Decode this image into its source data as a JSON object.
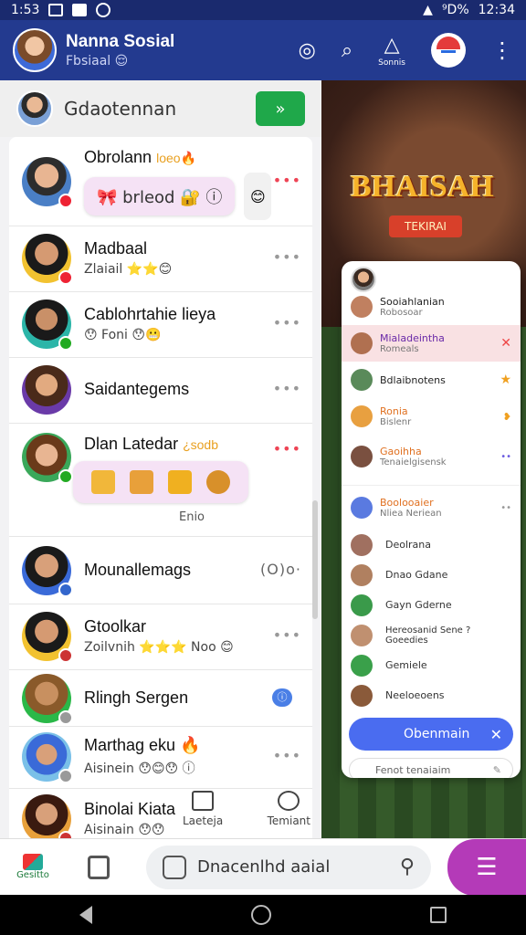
{
  "status": {
    "time": "1:53",
    "battery": "⁹D%",
    "clock": "12:34"
  },
  "app": {
    "title": "Nanna Sosial",
    "subtitle": "Fbsiaal 😌",
    "action_label": "Sonnis"
  },
  "search_head": {
    "name": "Gdaotennan"
  },
  "chats": [
    {
      "name": "Obrolann",
      "tag": "loeo🔥",
      "bubble": "🎀 brleod 🔐 ⓘ"
    },
    {
      "name": "Madbaal",
      "sub": "Zlaiail ⭐⭐😊"
    },
    {
      "name": "Cablohrtahie lieya",
      "sub": "😯 Foni 😯😬"
    },
    {
      "name": "Saidantegems"
    },
    {
      "name": "Dlan Latedar",
      "tag": "¿sodb",
      "caption": "Enio"
    },
    {
      "name": "Mounallemags",
      "trail": "(O)o·"
    },
    {
      "name": "Gtoolkar",
      "sub": "Zoilvnih ⭐⭐⭐ Noo 😊"
    },
    {
      "name": "Rlingh Sergen",
      "pill": "ⓘ"
    },
    {
      "name": "Marthag eku 🔥",
      "sub": "Aisinein 😯😊😯 ⓘ"
    },
    {
      "name": "Binolai Kiata",
      "sub": "Aisinain 😯😯"
    }
  ],
  "tabs": {
    "left": "Laeteja",
    "right": "Temiant"
  },
  "game": {
    "logo": "BHAISAH",
    "tag": "TEKIRAI"
  },
  "floating": {
    "rows": [
      {
        "t1": "Sooiahlanian",
        "t2": "Robosoar"
      },
      {
        "t1": "Mialadeintha",
        "t2": "Romeals"
      },
      {
        "t1": "Bdlaibnotens",
        "t2": ""
      },
      {
        "t1": "Ronia",
        "t2": "Bislenr"
      },
      {
        "t1": "Gaoihha",
        "t2": "Tenaielgisensk"
      }
    ],
    "group": {
      "t1": "Boolooaier",
      "t2": "Nliea Neriean"
    },
    "contacts": [
      "Deolrana",
      "Dnao Gdane",
      "Gayn Gderne",
      "Hereosanid Sene ? Goeedies",
      "Gemiele",
      "Neeloeoens"
    ],
    "button": "Obenmain",
    "input": "Fenot tenaiaim"
  },
  "bottom": {
    "home": "Gesitto",
    "search": "Dnacenlhd aaial"
  }
}
